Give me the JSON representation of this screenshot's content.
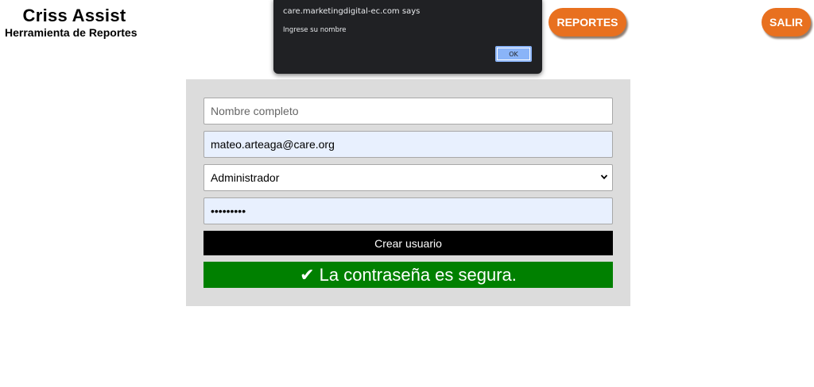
{
  "header": {
    "title": "Criss Assist",
    "subtitle": "Herramienta de Reportes",
    "reportes_label": "REPORTES",
    "salir_label": "SALIR"
  },
  "dialog": {
    "origin": "care.marketingdigital-ec.com says",
    "message": "Ingrese su nombre",
    "ok_label": "OK"
  },
  "form": {
    "name_placeholder": "Nombre completo",
    "name_value": "",
    "email_value": "mateo.arteaga@care.org",
    "role_selected": "Administrador",
    "password_value": "•••••••••",
    "create_label": "Crear usuario",
    "success_message": "✔ La contraseña es segura."
  },
  "colors": {
    "accent_orange": "#e8701f",
    "success_green": "#008000",
    "autofill_blue": "#e8f0fe",
    "panel_gray": "#dcdcdc",
    "dialog_dark": "#202124"
  },
  "icons": {
    "select_arrow": "chevron-down-icon"
  }
}
